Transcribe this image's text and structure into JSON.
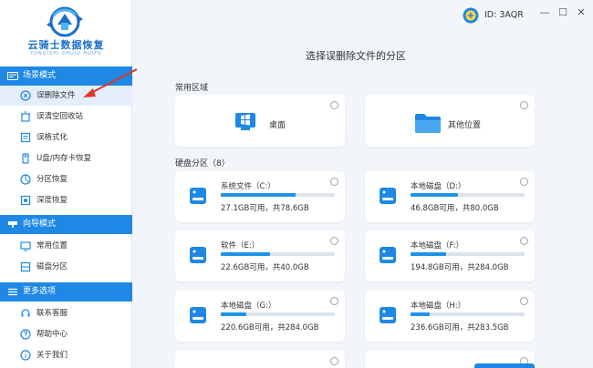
{
  "app": {
    "name": "云骑士数据恢复",
    "name_sub": "YUNQISHI SHUJU HUIFU"
  },
  "titlebar": {
    "id_label": "ID: 3AQR",
    "min_glyph": "—",
    "max_glyph": "☐",
    "close_glyph": "✕"
  },
  "sidebar": {
    "sections": [
      {
        "title": "场景模式",
        "items": [
          {
            "label": "误删除文件",
            "icon": "trash-file-icon",
            "active": true
          },
          {
            "label": "误清空回收站",
            "icon": "recycle-bin-icon"
          },
          {
            "label": "误格式化",
            "icon": "format-disk-icon"
          },
          {
            "label": "U盘/内存卡恢复",
            "icon": "usb-drive-icon"
          },
          {
            "label": "分区恢复",
            "icon": "partition-icon"
          },
          {
            "label": "深度恢复",
            "icon": "deep-scan-icon"
          }
        ]
      },
      {
        "title": "向导模式",
        "items": [
          {
            "label": "常用位置",
            "icon": "common-location-icon"
          },
          {
            "label": "磁盘分区",
            "icon": "disk-partition-icon"
          }
        ]
      },
      {
        "title": "更多选项",
        "items": [
          {
            "label": "联系客服",
            "icon": "customer-service-icon"
          },
          {
            "label": "帮助中心",
            "icon": "help-icon"
          },
          {
            "label": "关于我们",
            "icon": "about-icon"
          }
        ]
      }
    ]
  },
  "main": {
    "title": "选择误删除文件的分区",
    "common_label": "常用区域",
    "common": [
      {
        "label": "桌面",
        "icon": "desktop-windows-icon"
      },
      {
        "label": "其他位置",
        "icon": "folder-icon"
      }
    ],
    "disk_group_label": "硬盘分区（8）",
    "disks": [
      {
        "name": "系统文件（C:）",
        "info": "27.1GB可用，共78.6GB",
        "used_fraction": 0.655
      },
      {
        "name": "本地磁盘（D:）",
        "info": "46.8GB可用，共80.0GB",
        "used_fraction": 0.415
      },
      {
        "name": "软件（E:）",
        "info": "22.6GB可用，共40.0GB",
        "used_fraction": 0.435
      },
      {
        "name": "本地磁盘（F:）",
        "info": "194.8GB可用，共284.0GB",
        "used_fraction": 0.314
      },
      {
        "name": "本地磁盘（G:）",
        "info": "220.6GB可用，共284.0GB",
        "used_fraction": 0.223
      },
      {
        "name": "本地磁盘（H:）",
        "info": "236.6GB可用，共283.5GB",
        "used_fraction": 0.165
      }
    ]
  },
  "colors": {
    "accent": "#1f88e5",
    "bar_fill": "#1e93e6",
    "active_bg": "#e4eefb",
    "arrow": "#e0352b"
  }
}
